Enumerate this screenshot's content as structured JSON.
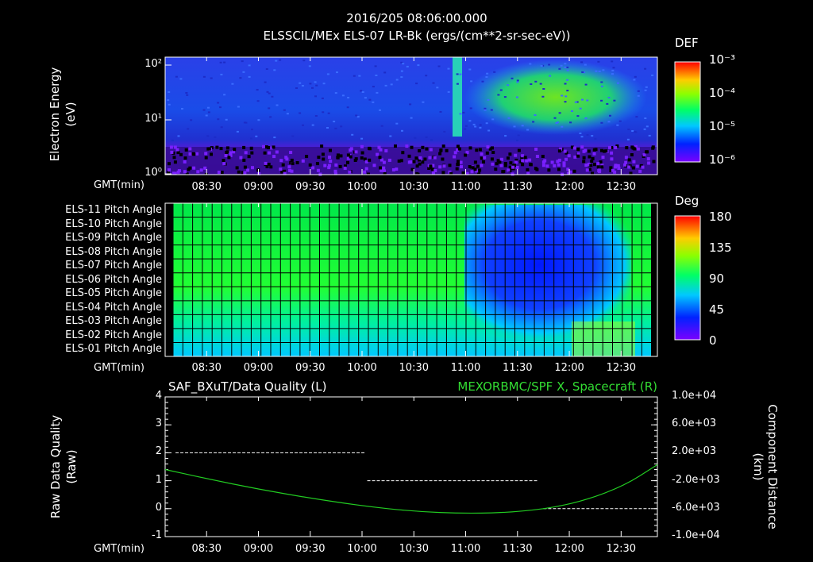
{
  "header": {
    "timestamp": "2016/205 08:06:00.000",
    "subtitle": "ELSSCIL/MEx ELS-07 LR-Bk   (ergs/(cm**2-sr-sec-eV))"
  },
  "colors": {
    "background": "#000000",
    "axis": "#ffffff",
    "quality_line": "#ffffff",
    "distance_line": "#22cc22",
    "right_title": "#33dd33"
  },
  "chart_data": [
    {
      "type": "heatmap",
      "name": "spectrogram",
      "ylabel": "Electron Energy (eV)",
      "ylabel_line1": "Electron Energy",
      "ylabel_line2": "(eV)",
      "yscale": "log",
      "ylim": [
        1,
        150
      ],
      "yticks": [
        "10²",
        "10¹",
        "10⁰"
      ],
      "xlabel": "GMT(min)",
      "xticks": [
        "08:30",
        "09:00",
        "09:30",
        "10:00",
        "10:30",
        "11:00",
        "11:30",
        "12:00",
        "12:30"
      ],
      "xlim": [
        "08:06",
        "12:51"
      ],
      "colorbar": {
        "title": "DEF",
        "scale": "log",
        "range": [
          1e-06,
          0.001
        ],
        "labels": [
          "10⁻³",
          "10⁻⁴",
          "10⁻⁵",
          "10⁻⁶"
        ]
      }
    },
    {
      "type": "heatmap",
      "name": "pitch-angle",
      "rows": [
        "ELS-11 Pitch Angle",
        "ELS-10 Pitch Angle",
        "ELS-09 Pitch Angle",
        "ELS-08 Pitch Angle",
        "ELS-07 Pitch Angle",
        "ELS-06 Pitch Angle",
        "ELS-05 Pitch Angle",
        "ELS-04 Pitch Angle",
        "ELS-03 Pitch Angle",
        "ELS-02 Pitch Angle",
        "ELS-01 Pitch Angle"
      ],
      "xlabel": "GMT(min)",
      "xticks": [
        "08:30",
        "09:00",
        "09:30",
        "10:00",
        "10:30",
        "11:00",
        "11:30",
        "12:00",
        "12:30"
      ],
      "colorbar": {
        "title": "Deg",
        "range": [
          0,
          180
        ],
        "labels": [
          "180",
          "135",
          "90",
          "45",
          "0"
        ]
      }
    },
    {
      "type": "line",
      "name": "quality-distance",
      "title_left": "SAF_BXuT/Data Quality (L)",
      "title_right": "MEXORBMC/SPF X, Spacecraft (R)",
      "ylabel_left_line1": "Raw Data Quality",
      "ylabel_left_line2": "(Raw)",
      "ylabel_right_line1": "Component Distance",
      "ylabel_right_line2": "(km)",
      "xlabel": "GMT(min)",
      "xticks": [
        "08:30",
        "09:00",
        "09:30",
        "10:00",
        "10:30",
        "11:00",
        "11:30",
        "12:00",
        "12:30"
      ],
      "yticks_left": [
        "4",
        "3",
        "2",
        "1",
        "0",
        "-1"
      ],
      "ylim_left": [
        -1,
        4
      ],
      "yticks_right": [
        "1.0e+04",
        "6.0e+03",
        "2.0e+03",
        "-2.0e+03",
        "-6.0e+03",
        "-1.0e+04"
      ],
      "ylim_right": [
        -10000,
        10000
      ],
      "series": [
        {
          "name": "SAF_BXuT/Data Quality",
          "axis": "left",
          "segments": [
            {
              "x": [
                "08:12",
                "10:02"
              ],
              "y": 2
            },
            {
              "x": [
                "10:03",
                "11:42"
              ],
              "y": 1
            },
            {
              "x": [
                "11:45",
                "12:47"
              ],
              "y": 0
            }
          ]
        },
        {
          "name": "MEXORBMC/SPF X, Spacecraft",
          "axis": "right",
          "x": [
            "08:06",
            "08:30",
            "09:00",
            "09:30",
            "10:00",
            "10:30",
            "11:00",
            "11:30",
            "12:00",
            "12:30",
            "12:51"
          ],
          "y": [
            -400,
            -1700,
            -3200,
            -4500,
            -5600,
            -6400,
            -6700,
            -6500,
            -5500,
            -3000,
            300
          ]
        }
      ]
    }
  ]
}
